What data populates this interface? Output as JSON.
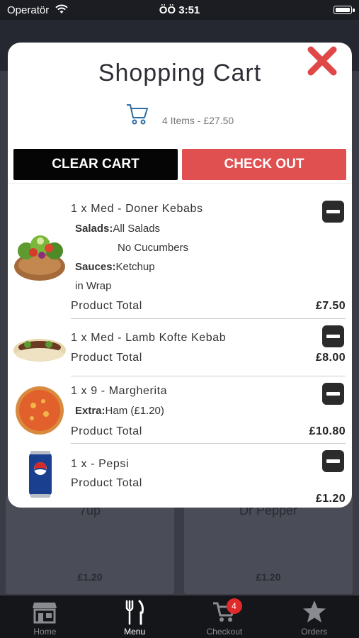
{
  "status_bar": {
    "carrier": "Operatör",
    "time": "ÖÖ 3:51"
  },
  "modal": {
    "title": "Shopping Cart",
    "summary": "4 Items - £27.50",
    "clear_label": "CLEAR CART",
    "checkout_label": "CHECK OUT",
    "items": [
      {
        "line": "1 x Med - Doner Kebabs",
        "salads_label": "Salads:",
        "salads_value": "All Salads",
        "salads_extra": "No Cucumbers",
        "sauces_label": "Sauces:",
        "sauces_value": "Ketchup",
        "wrap": "in Wrap",
        "total_label": "Product Total",
        "total": "£7.50"
      },
      {
        "line": "1 x Med - Lamb Kofte Kebab",
        "total_label": "Product Total",
        "total": "£8.00"
      },
      {
        "line": "1 x 9 - Margherita",
        "extra_label": "Extra:",
        "extra_value": "Ham (£1.20)",
        "total_label": "Product Total",
        "total": "£10.80"
      },
      {
        "line": "1 x - Pepsi",
        "total_label": "Product Total",
        "total": "£1.20"
      }
    ]
  },
  "background": {
    "cards": [
      {
        "name": "7up",
        "price": "£1.20"
      },
      {
        "name": "Dr Pepper",
        "price": "£1.20"
      }
    ]
  },
  "tab_bar": {
    "tabs": [
      {
        "label": "Home",
        "icon": "store-icon"
      },
      {
        "label": "Menu",
        "icon": "fork-knife-icon"
      },
      {
        "label": "Checkout",
        "icon": "cart-icon",
        "badge": "4"
      },
      {
        "label": "Orders",
        "icon": "star-icon"
      }
    ]
  },
  "colors": {
    "checkout": "#e05050",
    "close": "#e04848",
    "badge": "#e02a2a",
    "tab_bar": "#15161a"
  }
}
